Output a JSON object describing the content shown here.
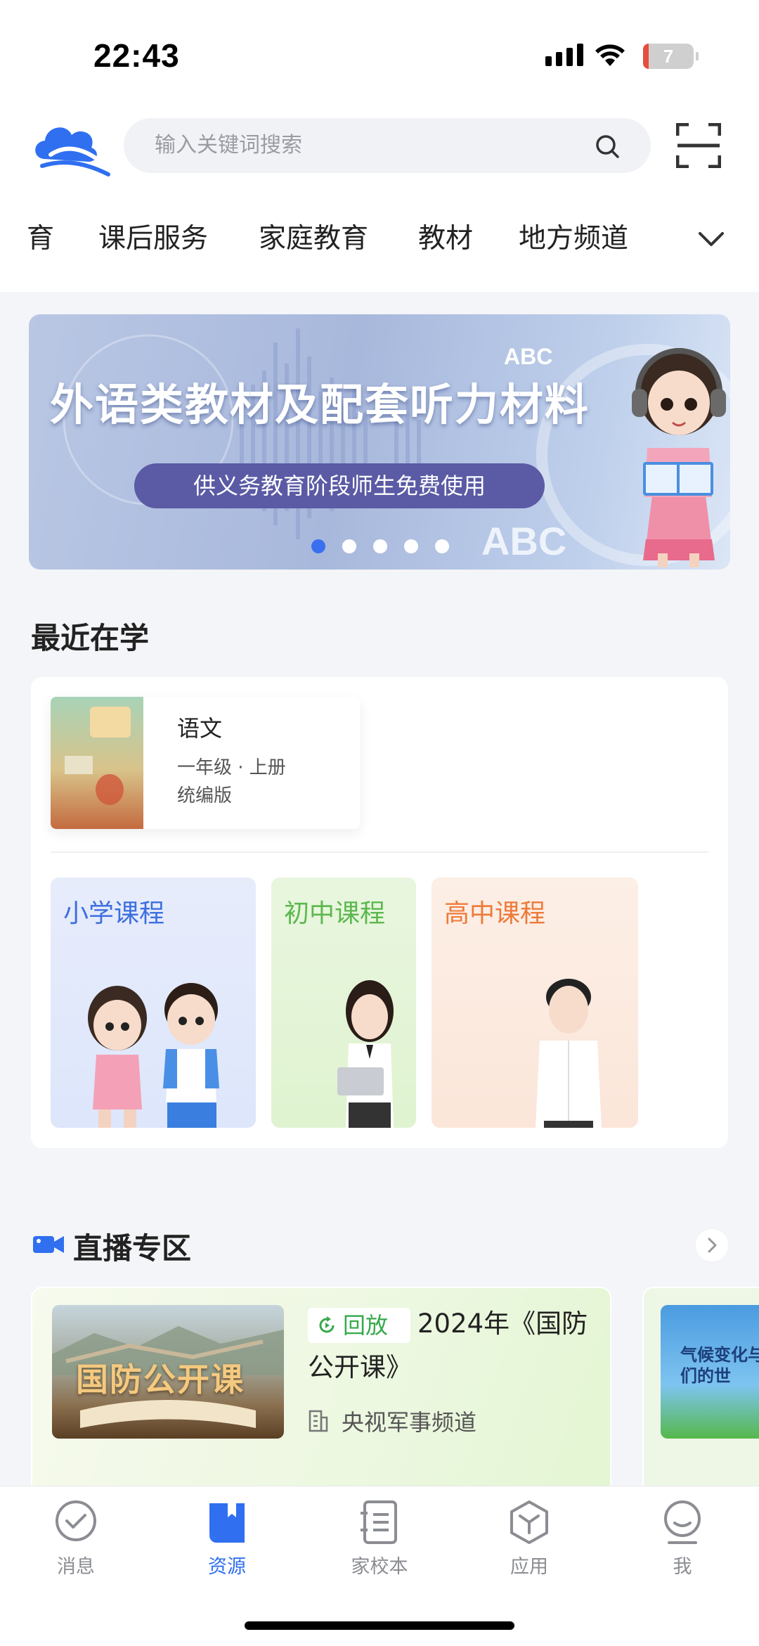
{
  "status_bar": {
    "time": "22:43",
    "battery": "7"
  },
  "search": {
    "placeholder": "输入关键词搜索"
  },
  "category_tabs": [
    "育",
    "课后服务",
    "家庭教育",
    "教材",
    "地方频道"
  ],
  "banner": {
    "title": "外语类教材及配套听力材料",
    "subtitle": "供义务教育阶段师生免费使用",
    "abc_small": "ABC",
    "abc_large": "ABC",
    "slide_count": 5,
    "active_slide": 1
  },
  "recent": {
    "title": "最近在学",
    "book": {
      "name": "语文",
      "grade": "一年级 · 上册",
      "edition": "统编版"
    }
  },
  "courses": [
    {
      "label": "小学课程",
      "color": "#3d6fe0"
    },
    {
      "label": "初中课程",
      "color": "#5cb84e"
    },
    {
      "label": "高中课程",
      "color": "#ee7a3a"
    }
  ],
  "live": {
    "title": "直播专区",
    "card": {
      "thumb_text": "国防公开课",
      "badge": "回放",
      "name": "2024年《国防公开课》",
      "channel": "央视军事频道"
    },
    "card2": {
      "thumb_text": "气候变化与我们的世"
    }
  },
  "tabbar": [
    {
      "label": "消息",
      "icon": "message-check-icon",
      "active": false
    },
    {
      "label": "资源",
      "icon": "book-icon",
      "active": true
    },
    {
      "label": "家校本",
      "icon": "notebook-icon",
      "active": false
    },
    {
      "label": "应用",
      "icon": "apps-icon",
      "active": false
    },
    {
      "label": "我",
      "icon": "profile-icon",
      "active": false
    }
  ],
  "colors": {
    "accent": "#2f6ff0",
    "replay_green": "#35a94a"
  }
}
